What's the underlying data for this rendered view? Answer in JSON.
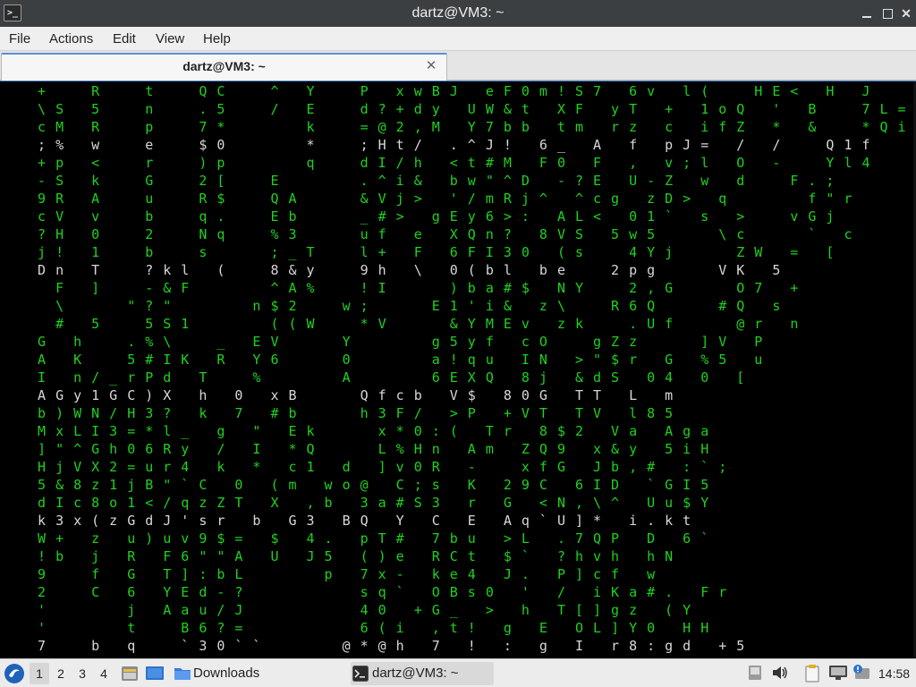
{
  "window": {
    "title": "dartz@VM3: ~",
    "icons": {
      "app": "terminal-icon",
      "minimize": "minimize-icon",
      "maximize": "maximize-icon",
      "close": "close-icon"
    }
  },
  "menubar": {
    "items": [
      "File",
      "Actions",
      "Edit",
      "View",
      "Help"
    ]
  },
  "tabs": [
    {
      "label": "dartz@VM3: ~",
      "close_icon": "close-icon"
    }
  ],
  "terminal": {
    "colors": {
      "background": "#000000",
      "green": "#1fd21f",
      "white": "#d8d8d8"
    },
    "rows": [
      "  +  R  t  QC  ^ Y  P xwBJ eF0m!S7 6v l(  HE< H J  z)/",
      "  \\S 5  n  .5  / E  d?+dy UW&t XF yT + 1oQ ' B  7L=",
      "  cM R  p  7*    k  =@2,M Y7bb tm rz c ifZ * &  *Qi",
      "  ;% w  e  $0    *  ;Ht/ .^J! 6_ A f pJ= / /  Q1f",
      "  +p <  r  )p    q  dI/h <t#M F0 F , v;l O -  Yl4",
      "  -S k  G  2[  E    .^i& bw\"^D -?E U-Z w d  F.;",
      "  9R A  u  R$  QA   &Vj> '/mRj^ ^cg zD> q    f\"r",
      "  cV v  b  q.  Eb   _#> gEy6>: AL< 01` s >  vGj",
      "  ?H 0  2  Nq  %3   uf e XQn? 8VS 5w5   \\c   ` c",
      "  j! 1  b  s   ;_T  l+ F 6FI30 (s  4Yj   ZW = [",
      "  Dn T  ?kl (  8&y  9h \\ 0(bl be  2pg   VK 5",
      "   F ]  -&F    ^A%  !I   )ba#$ NY  2,G   O7 +",
      "   \\   \"?\"    n$2  w;   E1'i& z\\  R6Q   #Q s",
      "   # 5  5S1    ((W  *V   &YMEv zk  .Uf   @r n",
      "  G h  .%\\  _ EV   Y    g5yf cO  gZz   ]V P",
      "  A K  5#IK R Y6   0    a!qu IN >\"$r G %5 u",
      "  I n/_rPd T  %    A    6EXQ 8j &dS 04 0 [",
      "  AGy1GC)X h 0 xB   Qfcb V$ 80G TT L m",
      "  b)WN/H3? k 7 #b   h3F/ >P +VT TV l85",
      "  MxLI3=*l_ g \" Ek   x*0:( Tr 8$2 Va Aga",
      "  ]\"^Gh06Ry / I *Q   L%Hn Am ZQ9 x&y 5iH",
      "  HjVX2=ur4 k * c1 d ]v0R -  xfG Jb,# :`;",
      "  5&8z1jB\"`C 0 (m wo@ C;s K 29C 6ID `GI5",
      "  dIc8o1</qzZT X ,b 3a#S3 r G <N,\\^ Uu$Y",
      "  k3x(zGdJ'sr b G3 BQ Y C E Aq`U]* i.kt",
      "  W+ z u)uv9$= $ 4. pT# 7bu >L .7QP D 6`",
      "  !b j R F6\"\"A U J5 ()e RCt $` ?hvh hN",
      "  9  f G T]:bL    p 7x- ke4 J. P]cf w",
      "  2  C 6 YEd-?      sq` OBs0 ' / iKa#. Fr",
      "  '    j Aau/J      40 +G_ > h T[]gz (Y",
      "  '    t  B6?=      6(i ,t! g E OL]Y0 HH",
      "  7  b q  `30``    @*@h 7 ! : g I r8:gd +5"
    ]
  },
  "taskbar": {
    "start_icon": "start-menu-icon",
    "workspaces": [
      "1",
      "2",
      "3",
      "4"
    ],
    "launchers": [
      {
        "name": "file-manager-launcher",
        "icon": "file-manager-icon"
      },
      {
        "name": "show-desktop-button",
        "icon": "desktop-icon"
      }
    ],
    "tasks": [
      {
        "label": "Downloads",
        "icon": "folder-icon"
      },
      {
        "label": "dartz@VM3: ~",
        "icon": "terminal-icon"
      }
    ],
    "tray": [
      "media-player-icon",
      "volume-icon",
      "clipboard-icon",
      "network-icon",
      "update-notifier-icon"
    ],
    "clock": "14:58"
  }
}
